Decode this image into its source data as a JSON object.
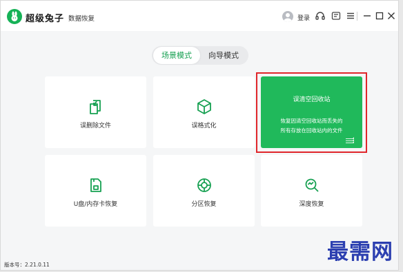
{
  "app": {
    "brand": "超级兔子",
    "subtitle": "数据恢复",
    "login_label": "登录",
    "version": "版本号：2.21.0.11"
  },
  "icons": {
    "logo": "rabbit-logo-icon",
    "avatar": "user-avatar-icon",
    "service": "headset-icon",
    "feedback": "feedback-icon",
    "menu": "hamburger-menu-icon",
    "minimize": "minimize-icon",
    "maximize": "maximize-icon",
    "close": "close-icon"
  },
  "mode_tabs": [
    {
      "label": "场景模式",
      "active": true
    },
    {
      "label": "向导模式",
      "active": false
    }
  ],
  "cards": [
    {
      "label": "误删除文件",
      "icon": "restore-file-icon"
    },
    {
      "label": "误格式化",
      "icon": "cube-format-icon"
    },
    {
      "title": "误清空回收站",
      "desc_line1": "恢复因清空回收站而丢失的",
      "desc_line2": "所有存放在回收站内的文件",
      "icon": "arrow-stack-icon",
      "featured": true
    },
    {
      "label": "U盘/内存卡恢复",
      "icon": "sd-card-icon"
    },
    {
      "label": "分区恢复",
      "icon": "partition-icon"
    },
    {
      "label": "深度恢复",
      "icon": "deep-scan-icon"
    }
  ],
  "watermark": "最需网",
  "colors": {
    "accent": "#20b95b",
    "highlight": "#e0252a",
    "watermark": "#2c3fb0"
  }
}
